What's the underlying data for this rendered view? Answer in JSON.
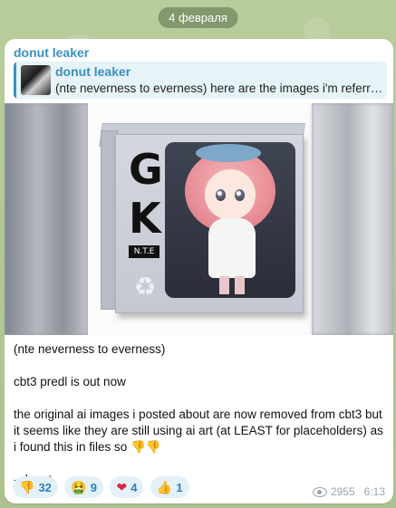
{
  "date_label": "4 февраля",
  "message": {
    "sender": "donut leaker",
    "reply": {
      "name": "donut leaker",
      "text": "(nte neverness to everness)  here are the images i'm referring to"
    },
    "image": {
      "box_letters": [
        "G",
        "K"
      ],
      "box_label": "N.T.E",
      "recycle_icon": "recycle-icon"
    },
    "caption": [
      "(nte neverness to everness)",
      "cbt3 predl is out now",
      "the original ai images i posted about are now removed from cbt3 but it seems like they are still using ai art (at LEAST for placeholders) as i found this in files so 👎👎",
      "- donut"
    ],
    "reactions": [
      {
        "emoji": "👎",
        "count": "32"
      },
      {
        "emoji": "🤮",
        "count": "9"
      },
      {
        "emoji": "❤",
        "count": "4"
      },
      {
        "emoji": "👍",
        "count": "1"
      }
    ],
    "views": "2955",
    "time": "6:13"
  },
  "colors": {
    "accent": "#3a8fc1",
    "reply_bg": "#e6f3f7",
    "reaction_bg": "#e4f1f9",
    "chat_bg": "#b7c99a"
  }
}
